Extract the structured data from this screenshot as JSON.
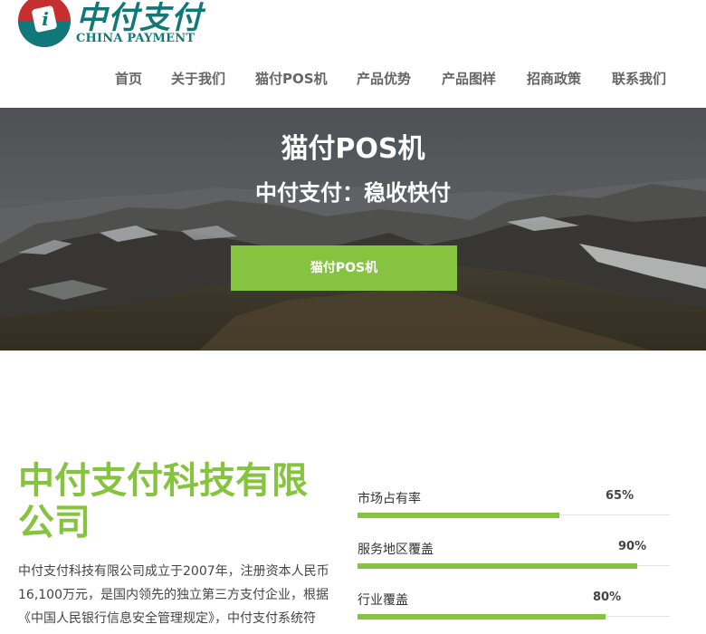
{
  "logo": {
    "glyph": "i",
    "name_cn": "中付支付",
    "name_en": "CHINA PAYMENT",
    "brand_color": "#11787a",
    "brand_red": "#c62f2f"
  },
  "nav": {
    "items": [
      {
        "label": "首页"
      },
      {
        "label": "关于我们"
      },
      {
        "label": "猫付POS机"
      },
      {
        "label": "产品优势"
      },
      {
        "label": "产品图样"
      },
      {
        "label": "招商政策"
      },
      {
        "label": "联系我们"
      }
    ]
  },
  "hero": {
    "title": "猫付POS机",
    "subtitle": "中付支付：稳收快付",
    "button_label": "猫付POS机",
    "accent": "#86c440"
  },
  "company": {
    "title": "中付支付科技有限公司",
    "description": "中付支付科技有限公司成立于2007年，注册资本人民币16,100万元，是国内领先的独立第三方支付企业，根据《中国人民银行信息安全管理规定》，中付支付系统符"
  },
  "stats": [
    {
      "label": "市场占有率",
      "value_text": "65%",
      "percent": 65
    },
    {
      "label": "服务地区覆盖",
      "value_text": "90%",
      "percent": 90
    },
    {
      "label": "行业覆盖",
      "value_text": "80%",
      "percent": 80
    }
  ]
}
